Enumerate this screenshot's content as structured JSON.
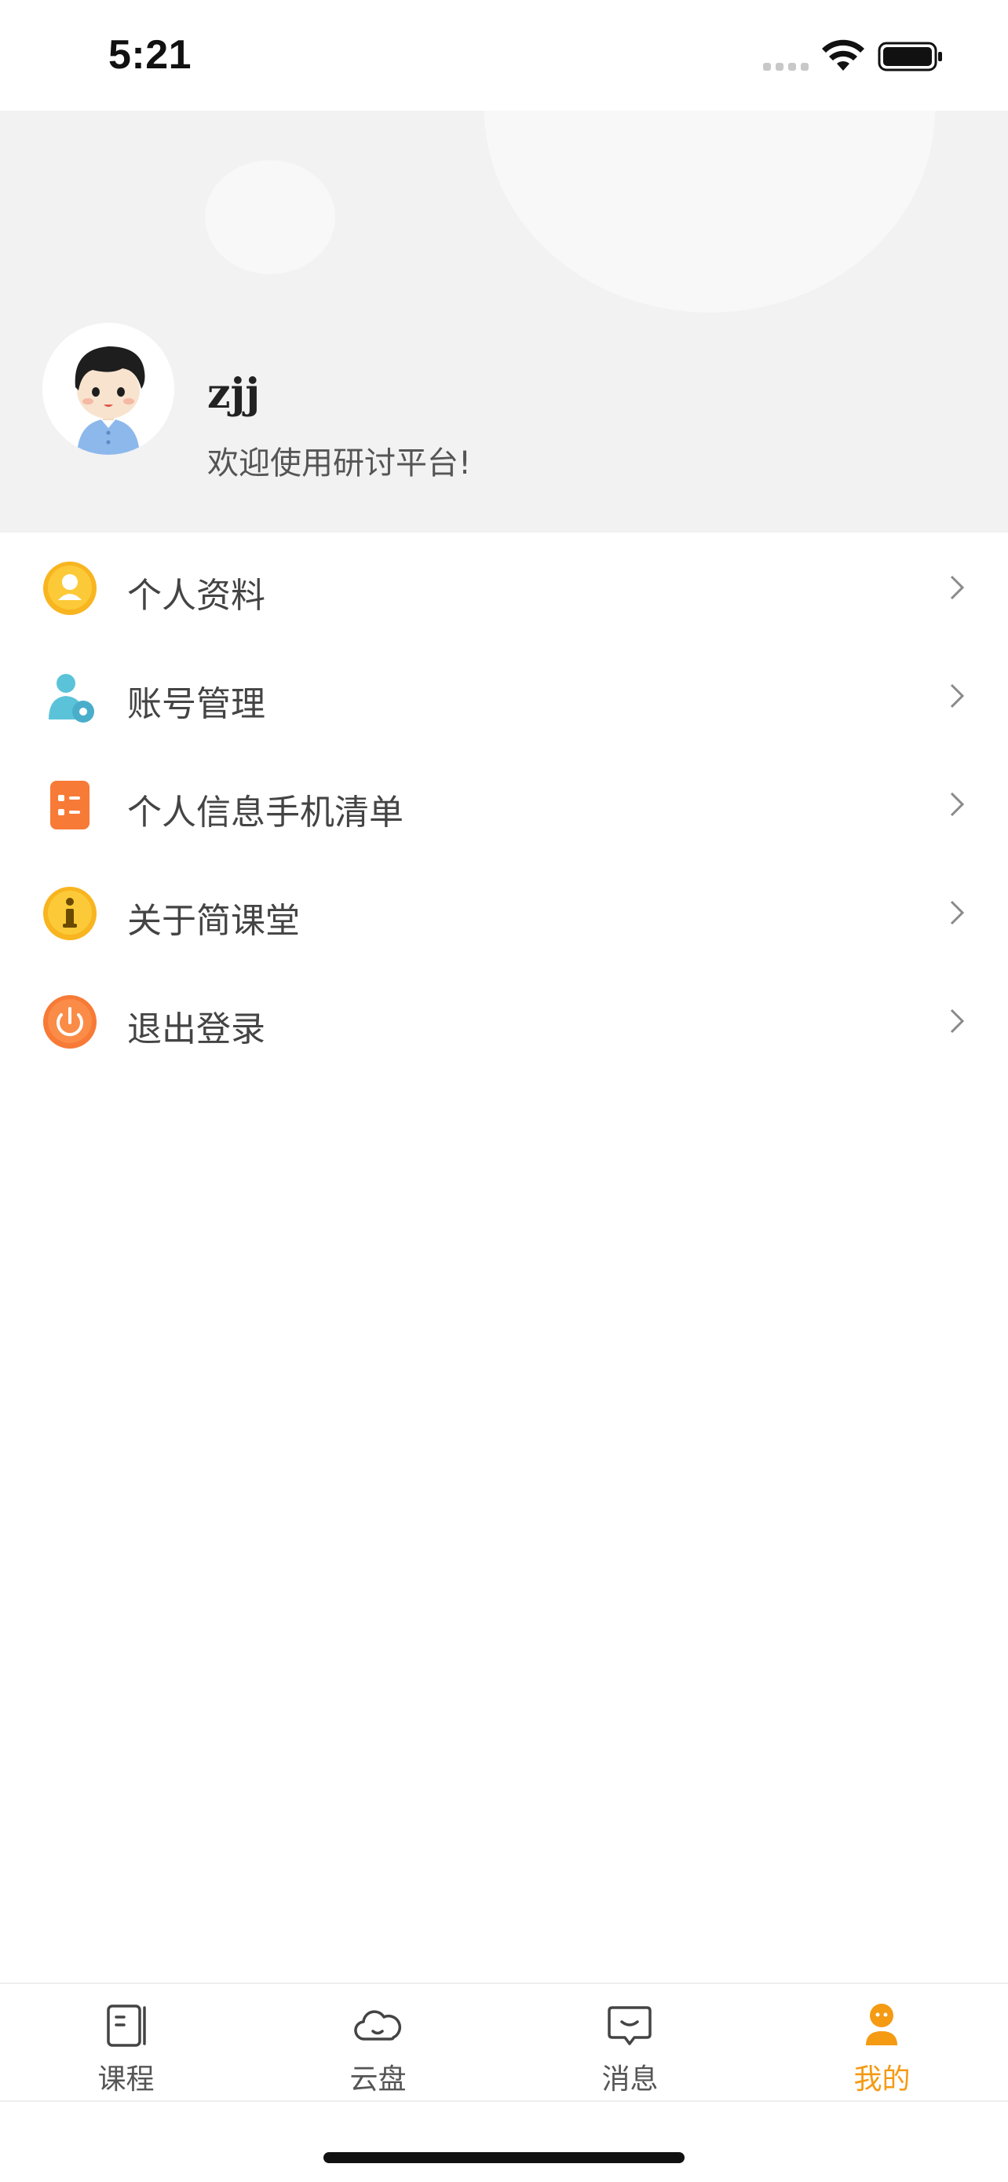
{
  "status_bar": {
    "time": "5:21"
  },
  "profile": {
    "name": "zjj",
    "welcome": "欢迎使用研讨平台!"
  },
  "menu": {
    "items": [
      {
        "label": "个人资料",
        "icon": "person-icon",
        "color": "#f8b520"
      },
      {
        "label": "账号管理",
        "icon": "account-settings-icon",
        "color": "#5bc3d9"
      },
      {
        "label": "个人信息手机清单",
        "icon": "list-icon",
        "color": "#f77a36"
      },
      {
        "label": "关于简课堂",
        "icon": "info-icon",
        "color": "#f8b520"
      },
      {
        "label": "退出登录",
        "icon": "power-icon",
        "color": "#f77a36"
      }
    ]
  },
  "tab_bar": {
    "tabs": [
      {
        "label": "课程",
        "icon": "book-icon",
        "active": false
      },
      {
        "label": "云盘",
        "icon": "cloud-icon",
        "active": false
      },
      {
        "label": "消息",
        "icon": "message-icon",
        "active": false
      },
      {
        "label": "我的",
        "icon": "profile-icon",
        "active": true
      }
    ]
  },
  "colors": {
    "accent": "#f59a13",
    "header_bg": "#f2f2f2"
  }
}
